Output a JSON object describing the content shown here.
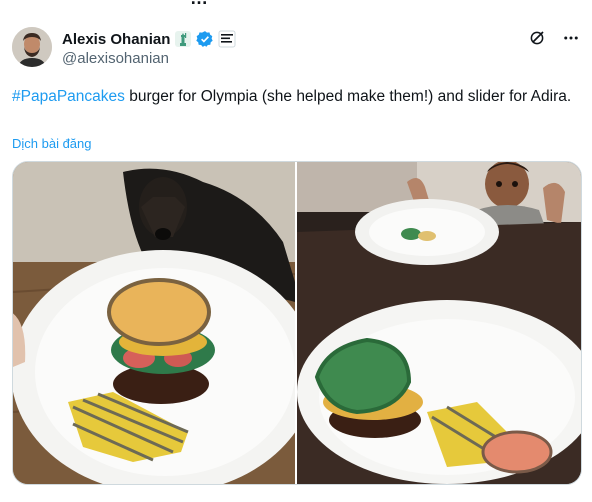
{
  "tweet": {
    "author_name": "Alexis Ohanian",
    "author_handle": "@alexisohanian",
    "hashtag": "#PapaPancakes",
    "text_rest": " burger for Olympia (she helped make them!) and slider for Adira.",
    "translate_label": "Dịch bài đăng"
  },
  "badges": [
    "statue-of-liberty-icon",
    "verified-icon",
    "affiliate-logo"
  ],
  "header_actions": [
    "grok-icon",
    "more-options-icon"
  ],
  "media": {
    "left_image": "pancake burger on paper plate with dog in background",
    "right_image": "child at table with plate, pancake slider in foreground"
  },
  "colors": {
    "accent": "#1d9bf0",
    "text": "#0f1419",
    "secondary_text": "#536471",
    "border": "#cfd9de"
  }
}
